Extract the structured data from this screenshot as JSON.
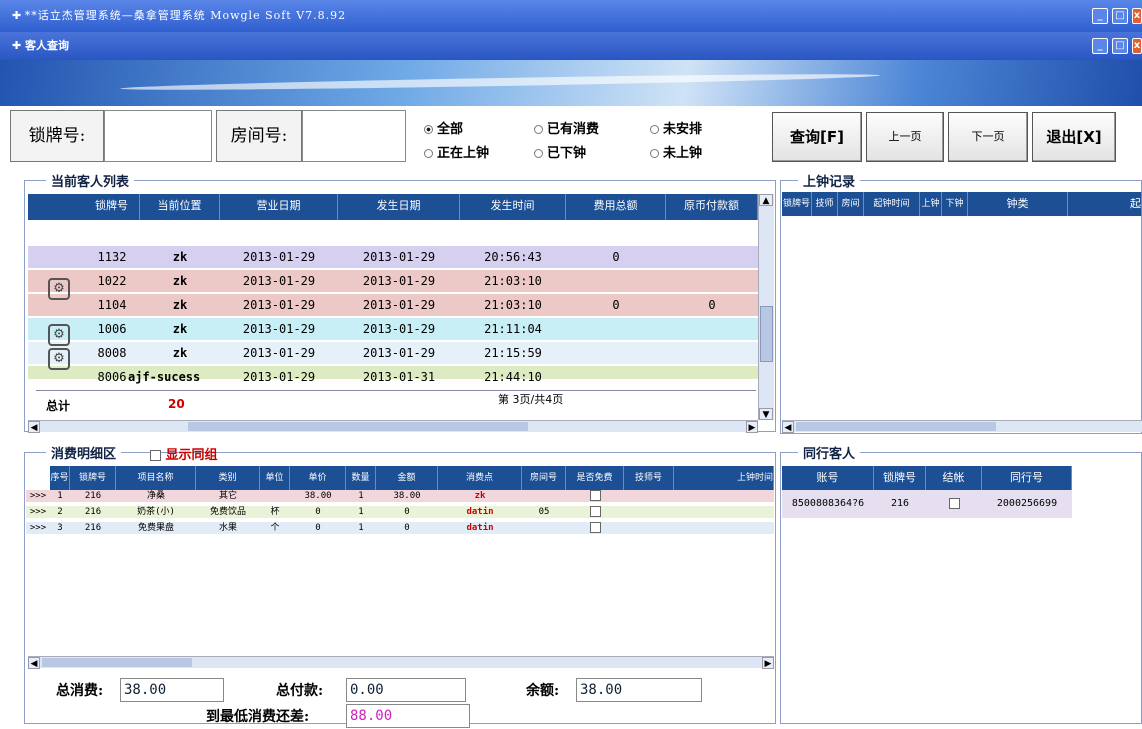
{
  "window": {
    "title": "**话立杰管理系统—桑拿管理系统    Mowgle Soft V7.8.92",
    "subtitle": "客人查询"
  },
  "search": {
    "lock_label": "锁牌号:",
    "room_label": "房间号:",
    "lock_value": "",
    "room_value": "",
    "radios": [
      {
        "label": "全部",
        "checked": true
      },
      {
        "label": "已有消费",
        "checked": false
      },
      {
        "label": "未安排",
        "checked": false
      },
      {
        "label": "正在上钟",
        "checked": false
      },
      {
        "label": "已下钟",
        "checked": false
      },
      {
        "label": "未上钟",
        "checked": false
      }
    ],
    "buttons": {
      "query": "查询[F]",
      "prev": "上一页",
      "next": "下一页",
      "exit": "退出[X]"
    }
  },
  "guest_list": {
    "legend": "当前客人列表",
    "columns": [
      "锁牌号",
      "当前位置",
      "营业日期",
      "发生日期",
      "发生时间",
      "费用总额",
      "原币付款额"
    ],
    "rows": [
      {
        "icon": false,
        "color": "#d7cff0",
        "lock": "1132",
        "pos": "zk",
        "bdate": "2013-01-29",
        "odate": "2013-01-29",
        "time": "20:56:43",
        "total": "0",
        "paid": ""
      },
      {
        "icon": true,
        "color": "#ecc9c7",
        "lock": "1022",
        "pos": "zk",
        "bdate": "2013-01-29",
        "odate": "2013-01-29",
        "time": "21:03:10",
        "total": "",
        "paid": ""
      },
      {
        "icon": false,
        "color": "#ecc9c7",
        "lock": "1104",
        "pos": "zk",
        "bdate": "2013-01-29",
        "odate": "2013-01-29",
        "time": "21:03:10",
        "total": "0",
        "paid": "0"
      },
      {
        "icon": true,
        "color": "#c8eef6",
        "lock": "1006",
        "pos": "zk",
        "bdate": "2013-01-29",
        "odate": "2013-01-29",
        "time": "21:11:04",
        "total": "",
        "paid": ""
      },
      {
        "icon": false,
        "color": "#e6f0f8",
        "lock": "8008",
        "pos": "zk",
        "bdate": "2013-01-29",
        "odate": "2013-01-29",
        "time": "21:15:59",
        "total": "",
        "paid": ""
      },
      {
        "icon": true,
        "color": "#dcebc2",
        "lock": "8006",
        "pos": "ajf-sucess",
        "bdate": "2013-01-29",
        "odate": "2013-01-31",
        "time": "21:44:10",
        "total": "",
        "paid": ""
      }
    ],
    "total_label": "总计",
    "total_value": "20",
    "page_info": "第 3页/共4页"
  },
  "clock_record": {
    "legend": "上钟记录",
    "columns": [
      "锁牌号",
      "技师",
      "房间",
      "起钟时间",
      "上钟",
      "下钟",
      "钟类",
      "起"
    ]
  },
  "consumption": {
    "legend": "消费明细区",
    "show_group_label": "显示同组",
    "columns": [
      "序号",
      "锁牌号",
      "项目名称",
      "类别",
      "单位",
      "单价",
      "数量",
      "金额",
      "消费点",
      "房间号",
      "是否免费",
      "技师号",
      "上钟时间"
    ],
    "rows": [
      {
        "mark": ">>>",
        "no": "1",
        "lock": "216",
        "name": "净桑",
        "cat": "其它",
        "unit": "",
        "price": "38.00",
        "qty": "1",
        "amount": "38.00",
        "point": "zk",
        "room": "",
        "color": "#f1d6dc"
      },
      {
        "mark": ">>>",
        "no": "2",
        "lock": "216",
        "name": "奶茶(小)",
        "cat": "免费饮品",
        "unit": "杯",
        "price": "0",
        "qty": "1",
        "amount": "0",
        "point": "datin",
        "room": "05",
        "color": "#eaf3d8"
      },
      {
        "mark": ">>>",
        "no": "3",
        "lock": "216",
        "name": "免费果盘",
        "cat": "水果",
        "unit": "个",
        "price": "0",
        "qty": "1",
        "amount": "0",
        "point": "datin",
        "room": "",
        "color": "#e2ecf6"
      }
    ]
  },
  "companions": {
    "legend": "同行客人",
    "columns": [
      "账号",
      "锁牌号",
      "结帐",
      "同行号"
    ],
    "rows": [
      {
        "account": "8500808364?6",
        "lock": "216",
        "group": "2000256699"
      }
    ]
  },
  "summary": {
    "total_consume_label": "总消费:",
    "total_consume": "38.00",
    "total_paid_label": "总付款:",
    "total_paid": "0.00",
    "balance_label": "余额:",
    "balance": "38.00",
    "min_diff_label": "到最低消费还差:",
    "min_diff": "88.00"
  }
}
